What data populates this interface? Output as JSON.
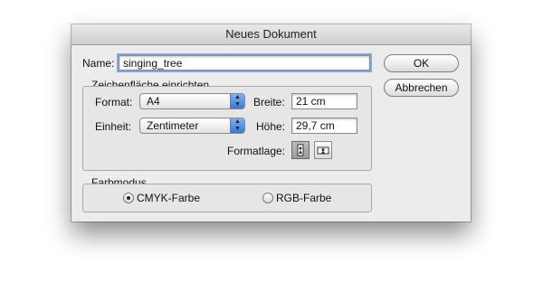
{
  "window": {
    "title": "Neues Dokument"
  },
  "name_field": {
    "label": "Name:",
    "value": "singing_tree"
  },
  "buttons": {
    "ok": "OK",
    "cancel": "Abbrechen"
  },
  "artboard": {
    "title": "Zeichenfläche einrichten",
    "format": {
      "label": "Format:",
      "value": "A4"
    },
    "unit": {
      "label": "Einheit:",
      "value": "Zentimeter"
    },
    "width": {
      "label": "Breite:",
      "value": "21 cm"
    },
    "height": {
      "label": "Höhe:",
      "value": "29,7 cm"
    },
    "orientation": {
      "label": "Formatlage:",
      "selected": "portrait"
    }
  },
  "color_mode": {
    "title": "Farbmodus",
    "options": [
      {
        "label": "CMYK-Farbe",
        "selected": true
      },
      {
        "label": "RGB-Farbe",
        "selected": false
      }
    ]
  }
}
